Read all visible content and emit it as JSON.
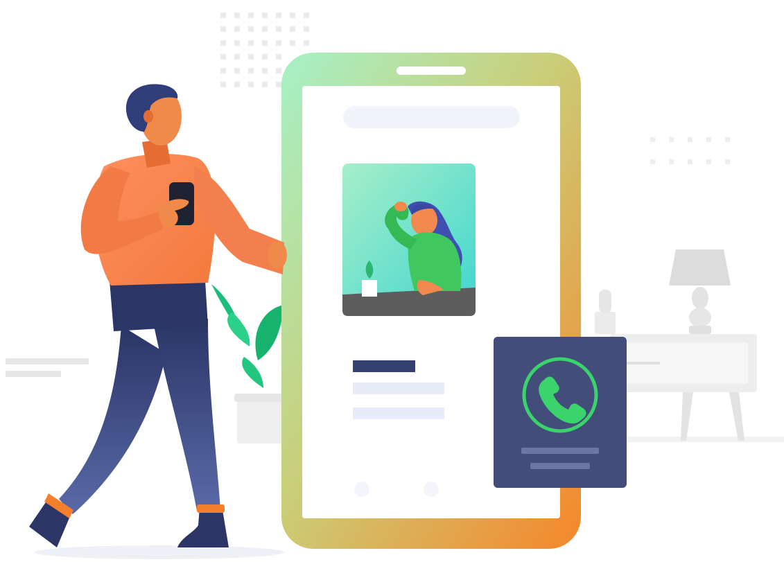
{
  "illustration": {
    "subject": "person-with-phone-video-call",
    "icons": {
      "call": "phone-call-icon",
      "phone": "smartphone-icon",
      "handheld": "handheld-phone-icon"
    }
  },
  "colors": {
    "background": "#ffffff",
    "shirt": "#f47f4e",
    "pants": "#2f3a72",
    "skin": "#f08a4b",
    "hair": "#2f3d79",
    "phone_gradient_top": "#a5f0c6",
    "phone_gradient_bottom": "#f68a2b",
    "call_card": "#434d79",
    "call_ring": "#3bd36b",
    "plant": "#1fbf7a",
    "furniture": "#ececec"
  }
}
